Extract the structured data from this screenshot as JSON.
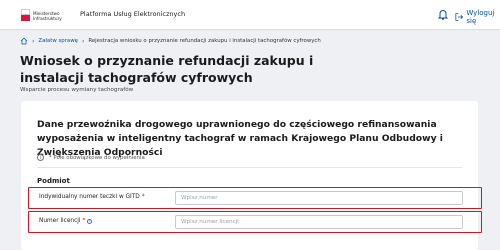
{
  "header": {
    "logo_line1": "Ministerstwo",
    "logo_line2": "Infrastruktury",
    "platform_name": "Platforma Usług Elektronicznych",
    "logout_label": "Wyloguj się"
  },
  "breadcrumb": {
    "items": [
      "Załatw sprawę",
      "Rejestracja wniosku o przyznanie refundacji zakupu i instalacji tachografów cyfrowych"
    ]
  },
  "page": {
    "title": "Wniosek o przyznanie refundacji zakupu i instalacji tachografów cyfrowych",
    "subtitle": "Wsparcie procesu wymiany tachografów"
  },
  "form": {
    "section_title": "Dane przewoźnika drogowego uprawnionego do częściowego refinansowania wyposażenia w inteligentny tachograf w ramach Krajowego Planu Odbudowy i Zwiększenia Odporności",
    "required_note": "* Pole obowiązkowe do wypełnienia",
    "subject_label": "Podmiot",
    "fields": [
      {
        "label": "Indywidualny numer teczki w GITD",
        "required_mark": "*",
        "placeholder": "Wpisz numer",
        "value": ""
      },
      {
        "label": "Numer licencji",
        "required_mark": "*",
        "placeholder": "Wpisz numer licencji",
        "value": ""
      }
    ]
  },
  "colors": {
    "accent": "#0052a5",
    "error_outline": "#d7141f"
  },
  "icons": [
    "bell-icon",
    "logout-icon",
    "home-icon",
    "info-icon"
  ]
}
